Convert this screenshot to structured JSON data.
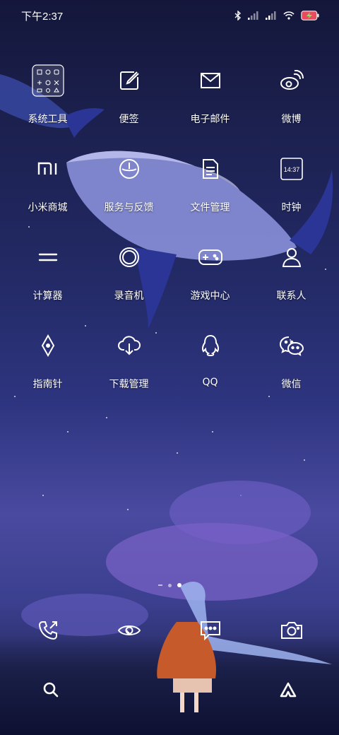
{
  "status_bar": {
    "time": "下午2:37",
    "icons": [
      "bluetooth-icon",
      "signal-icon",
      "signal-icon",
      "wifi-icon",
      "battery-charging-icon"
    ]
  },
  "apps": [
    {
      "label": "系统工具",
      "icon": "folder-icon"
    },
    {
      "label": "便签",
      "icon": "note-icon"
    },
    {
      "label": "电子邮件",
      "icon": "mail-icon"
    },
    {
      "label": "微博",
      "icon": "weibo-icon"
    },
    {
      "label": "小米商城",
      "icon": "mi-store-icon"
    },
    {
      "label": "服务与反馈",
      "icon": "service-icon"
    },
    {
      "label": "文件管理",
      "icon": "file-manager-icon"
    },
    {
      "label": "时钟",
      "icon": "clock-icon",
      "icon_text": "14:37"
    },
    {
      "label": "计算器",
      "icon": "calculator-icon"
    },
    {
      "label": "录音机",
      "icon": "recorder-icon"
    },
    {
      "label": "游戏中心",
      "icon": "gamepad-icon"
    },
    {
      "label": "联系人",
      "icon": "contacts-icon"
    },
    {
      "label": "指南针",
      "icon": "compass-icon"
    },
    {
      "label": "下载管理",
      "icon": "download-icon"
    },
    {
      "label": "QQ",
      "icon": "qq-icon"
    },
    {
      "label": "微信",
      "icon": "wechat-icon"
    }
  ],
  "page_indicator": {
    "pages": 3,
    "active": 2
  },
  "dock": [
    {
      "icon": "phone-icon"
    },
    {
      "icon": "browser-eye-icon"
    },
    {
      "icon": "messages-icon"
    },
    {
      "icon": "camera-icon"
    }
  ],
  "bottom_bar": {
    "left_icon": "search-icon",
    "right_icon": "assistant-icon"
  }
}
